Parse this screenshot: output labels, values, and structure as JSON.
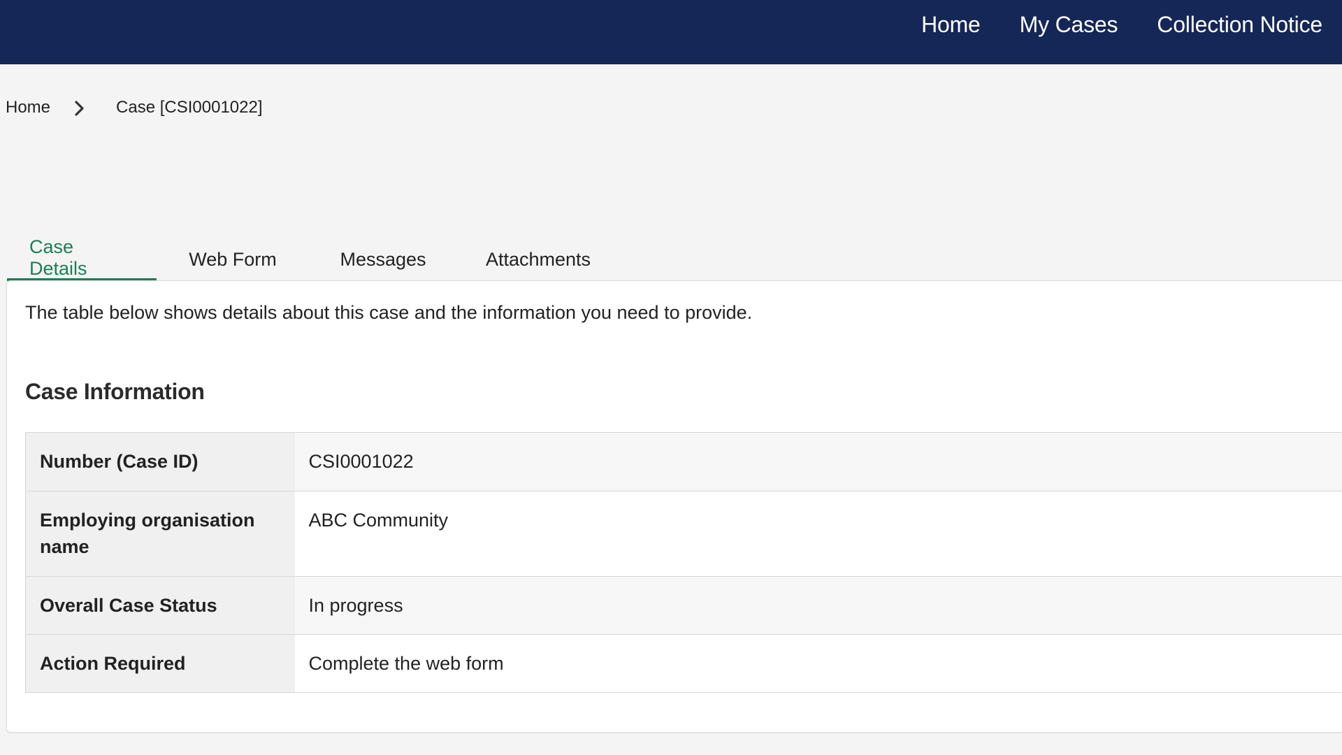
{
  "header": {
    "nav": [
      "Home",
      "My Cases",
      "Collection Notice"
    ],
    "background_color": "#152756"
  },
  "breadcrumb": {
    "home": "Home",
    "separator_icon": "chevron-right-icon",
    "current": "Case [CSI0001022]"
  },
  "tabs": [
    {
      "label": "Case Details",
      "active": true
    },
    {
      "label": "Web Form",
      "active": false
    },
    {
      "label": "Messages",
      "active": false
    },
    {
      "label": "Attachments",
      "active": false
    }
  ],
  "accent_color": "#1a7f55",
  "main": {
    "intro": "The table below shows details about this case and the information you need to provide.",
    "section_title": "Case Information",
    "rows": [
      {
        "label": "Number (Case ID)",
        "value": "CSI0001022"
      },
      {
        "label": "Employing organisation name",
        "value": "ABC Community"
      },
      {
        "label": "Overall Case Status",
        "value": "In progress"
      },
      {
        "label": "Action Required",
        "value": "Complete the web form"
      }
    ]
  }
}
